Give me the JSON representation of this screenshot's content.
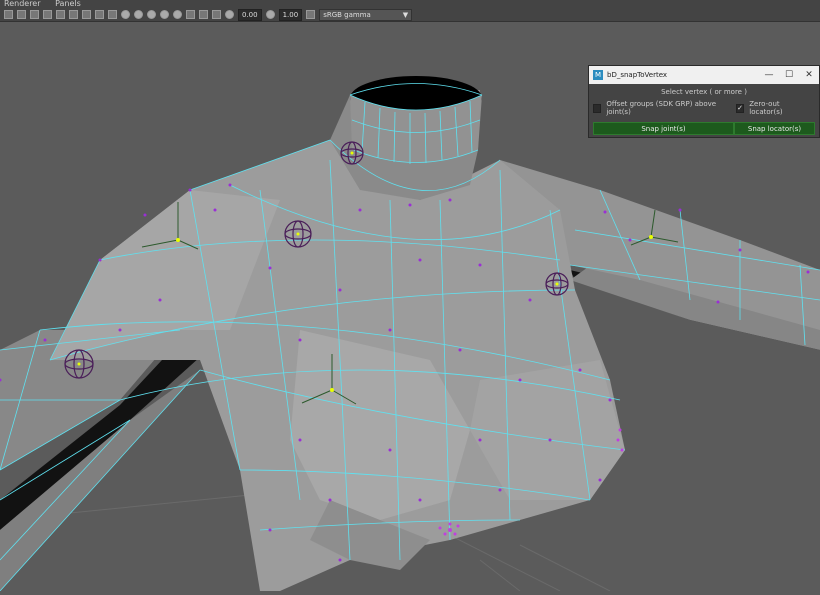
{
  "menubar": {
    "items": [
      "Renderer",
      "Panels"
    ]
  },
  "toolbar": {
    "value_a": "0.00",
    "value_b": "1.00",
    "color_space": "sRGB gamma"
  },
  "tool_window": {
    "title": "bD_snapToVertex",
    "hint": "Select vertex ( or more )",
    "option_offset_label": "Offset groups (SDK GRP) above joint(s)",
    "option_offset_checked": false,
    "option_zero_label": "Zero-out locator(s)",
    "option_zero_checked": true,
    "check_mark": "✓",
    "snap_joints_label": "Snap joint(s)",
    "snap_locators_label": "Snap locator(s)",
    "minimize_glyph": "—",
    "maximize_glyph": "☐",
    "close_glyph": "✕",
    "logo_glyph": "M"
  },
  "colors": {
    "wire": "#5fe1f0",
    "vertex": "#9a2fd6",
    "locator": "#4a1e59",
    "joint_center": "#e8ff00",
    "button_green": "#1d5a1d"
  }
}
